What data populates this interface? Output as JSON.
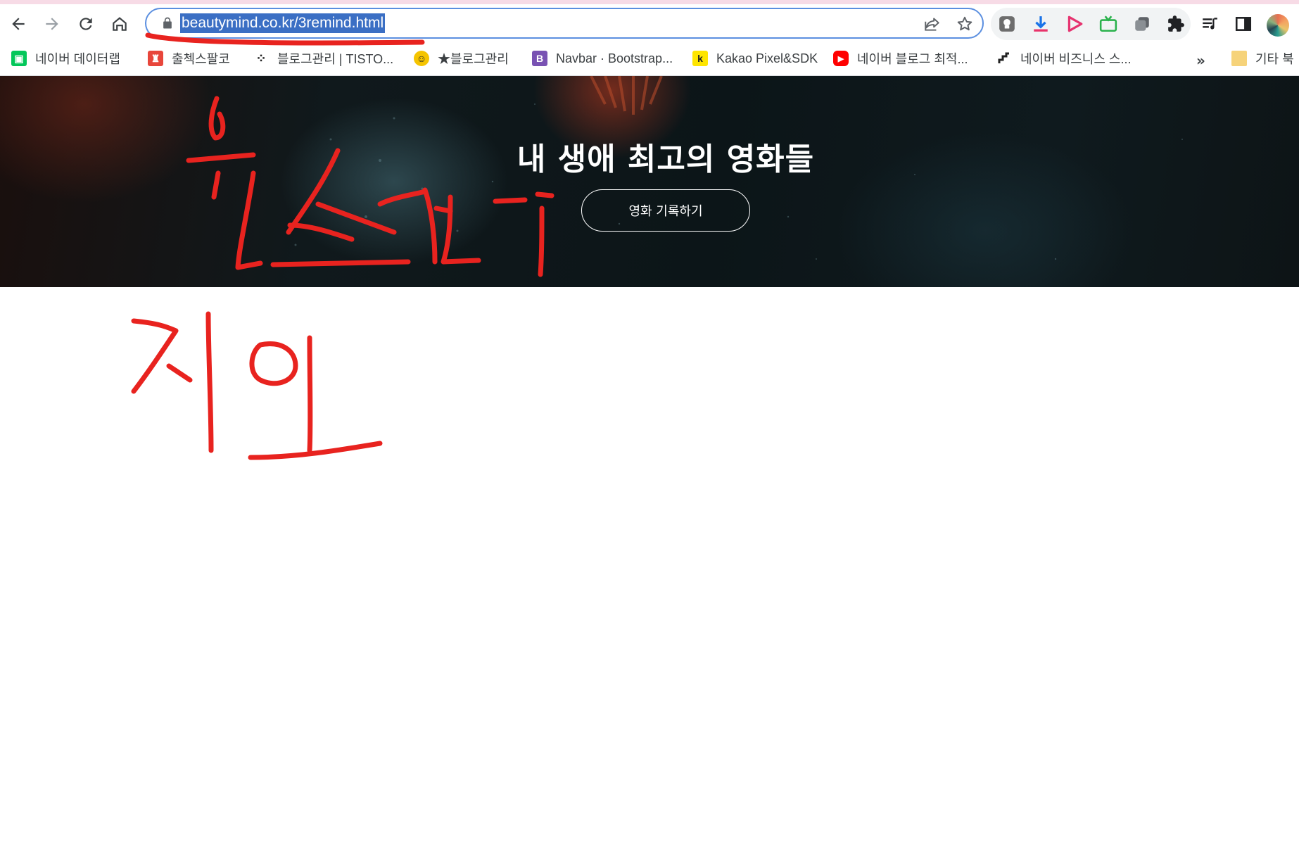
{
  "browser": {
    "url": "beautymind.co.kr/3remind.html",
    "toolbar": {
      "back_icon": "back-arrow-icon",
      "forward_icon": "forward-arrow-icon",
      "reload_icon": "reload-icon",
      "home_icon": "home-icon"
    },
    "bookmarks": [
      {
        "label": "네이버 데이터랩",
        "icon": "naver-datalab-icon",
        "color": "#03c75a"
      },
      {
        "label": "출첵스팔코",
        "icon": "spartan-icon",
        "color": "#e8463b"
      },
      {
        "label": "블로그관리 | TISTO...",
        "icon": "tistory-icon",
        "color": "#222222"
      },
      {
        "label": "★블로그관리",
        "icon": "blog-face-icon",
        "color": "#f5c400"
      },
      {
        "label": "Navbar · Bootstrap...",
        "icon": "bootstrap-icon",
        "color": "#7952b3",
        "letter": "B"
      },
      {
        "label": "Kakao Pixel&SDK",
        "icon": "kakao-icon",
        "color": "#fee500",
        "letter": "k"
      },
      {
        "label": "네이버 블로그 최적...",
        "icon": "youtube-icon",
        "color": "#ff0000"
      },
      {
        "label": "네이버 비즈니스 스...",
        "icon": "stairs-icon",
        "color": "#222222"
      }
    ],
    "more_label": "»",
    "other_bookmarks": "기타 북"
  },
  "hero": {
    "title": "내 생애 최고의 영화들",
    "button_label": "영화 기록하기"
  }
}
